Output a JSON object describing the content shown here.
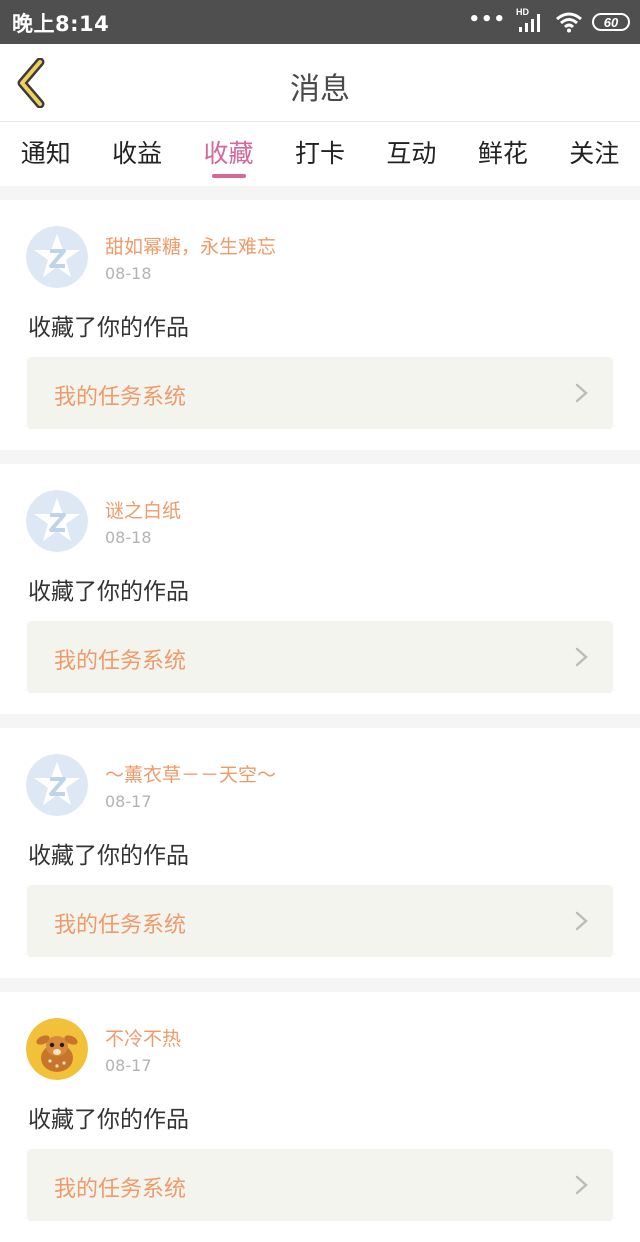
{
  "status_bar": {
    "time": "晚上8:14",
    "network": "HD",
    "battery": "60",
    "icons": [
      "dots-icon",
      "signal-icon",
      "wifi-icon",
      "battery-icon"
    ]
  },
  "header": {
    "title": "消息",
    "back_icon": "chevron-left-icon"
  },
  "tabs": [
    {
      "label": "通知",
      "active": false
    },
    {
      "label": "收益",
      "active": false
    },
    {
      "label": "收藏",
      "active": true
    },
    {
      "label": "打卡",
      "active": false
    },
    {
      "label": "互动",
      "active": false
    },
    {
      "label": "鲜花",
      "active": false
    },
    {
      "label": "关注",
      "active": false
    }
  ],
  "colors": {
    "accent": "#d5679a",
    "username": "#ee9b6a",
    "status_bar_bg": "#4f4f4f",
    "task_bg": "#f4f4ef"
  },
  "messages": [
    {
      "username": "甜如幂糖，永生难忘",
      "date": "08-18",
      "action": "收藏了你的作品",
      "task": "我的任务系统",
      "avatar": "default-star-avatar"
    },
    {
      "username": "谜之白纸",
      "date": "08-18",
      "action": "收藏了你的作品",
      "task": "我的任务系统",
      "avatar": "default-star-avatar"
    },
    {
      "username": "～薰衣草－－天空～",
      "date": "08-17",
      "action": "收藏了你的作品",
      "task": "我的任务系统",
      "avatar": "default-star-avatar"
    },
    {
      "username": "不冷不热",
      "date": "08-17",
      "action": "收藏了你的作品",
      "task": "我的任务系统",
      "avatar": "deer-avatar"
    }
  ]
}
